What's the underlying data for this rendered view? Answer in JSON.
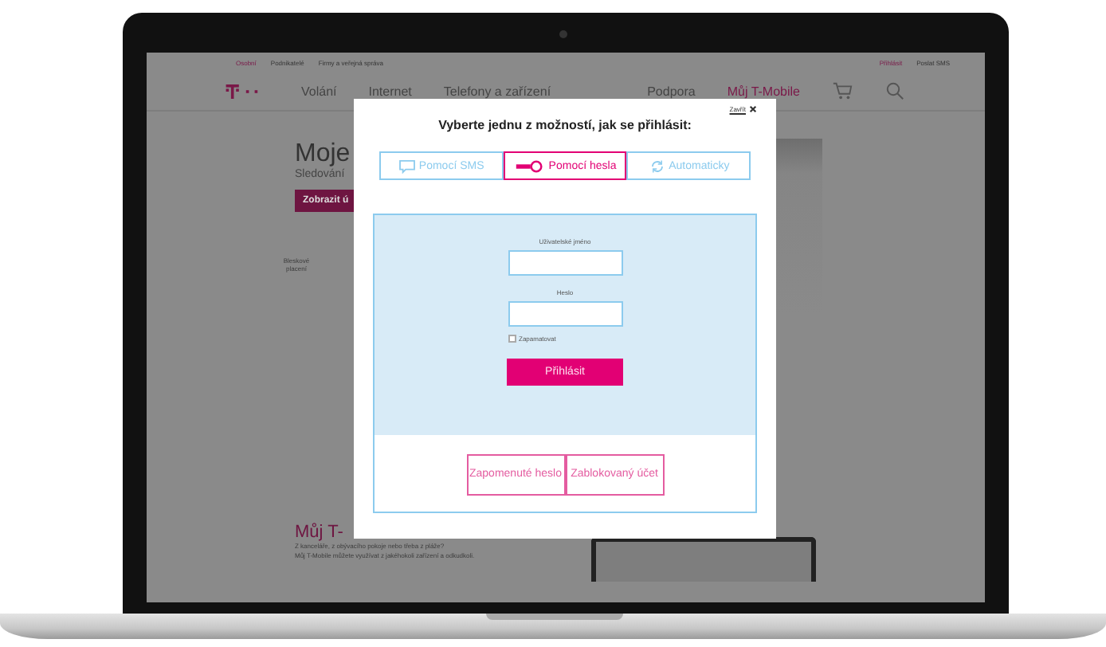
{
  "top_links": [
    {
      "label": "Osobní",
      "selected": true
    },
    {
      "label": "Podnikatelé",
      "selected": false
    },
    {
      "label": "Firmy a veřejná správa",
      "selected": false
    }
  ],
  "account_links": [
    {
      "label": "Přihlásit",
      "highlighted": true
    },
    {
      "label": "Poslat SMS",
      "highlighted": false
    }
  ],
  "nav": [
    {
      "label": "Volání",
      "selected": false
    },
    {
      "label": "Internet",
      "selected": false
    },
    {
      "label": "Telefony a zařízení",
      "selected": false
    },
    {
      "label": "Podpora",
      "selected": false
    },
    {
      "label": "Můj T-Mobile",
      "selected": true
    }
  ],
  "hero": {
    "title": "Moje",
    "subtitle": "Sledování",
    "button": "Zobrazit ú"
  },
  "feature": {
    "label": "Bleskové placení"
  },
  "section": {
    "title": "Můj T-",
    "lines": [
      "Z kanceláře, z obývacího pokoje nebo třeba z pláže?",
      "Můj T-Mobile můžete využívat z jakéhokoli zařízení a odkudkoli."
    ]
  },
  "dialog": {
    "close": "Zavřít",
    "title": "Vyberte jednu z možností, jak se přihlásit:",
    "methods": [
      {
        "label": "Pomocí SMS",
        "selected": false
      },
      {
        "label": "Pomocí hesla",
        "selected": true
      },
      {
        "label": "Automaticky",
        "selected": false
      }
    ],
    "form": {
      "username_label": "Uživatelské jméno",
      "password_label": "Heslo",
      "remember": {
        "label": "Zapamatovat",
        "checked": false
      },
      "submit": "Přihlásit"
    },
    "links": [
      "Zapomenuté heslo",
      "Zablokovaný účet"
    ]
  }
}
